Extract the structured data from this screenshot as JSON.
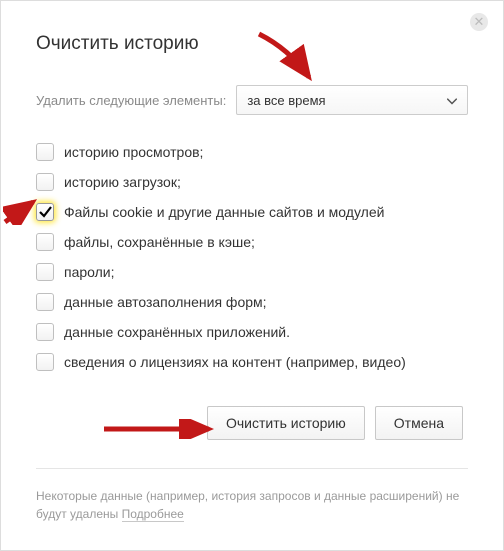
{
  "dialog": {
    "title": "Очистить историю",
    "time_label": "Удалить следующие элементы:",
    "time_value": "за все время",
    "options": [
      {
        "label": "историю просмотров;",
        "checked": false
      },
      {
        "label": "историю загрузок;",
        "checked": false
      },
      {
        "label": "Файлы cookie и другие данные сайтов и модулей",
        "checked": true
      },
      {
        "label": "файлы, сохранённые в кэше;",
        "checked": false
      },
      {
        "label": "пароли;",
        "checked": false
      },
      {
        "label": "данные автозаполнения форм;",
        "checked": false
      },
      {
        "label": "данные сохранённых приложений.",
        "checked": false
      },
      {
        "label": "сведения о лицензиях на контент (например, видео)",
        "checked": false
      }
    ],
    "clear_button": "Очистить историю",
    "cancel_button": "Отмена",
    "footer_text": "Некоторые данные (например, история запросов и данные расширений) не будут удалены ",
    "footer_link": "Подробнее"
  },
  "icons": {
    "close": "close-icon",
    "chevron": "chevron-down-icon",
    "check": "check-icon"
  },
  "colors": {
    "accent_highlight": "#ffe632",
    "arrow": "#c21818"
  }
}
